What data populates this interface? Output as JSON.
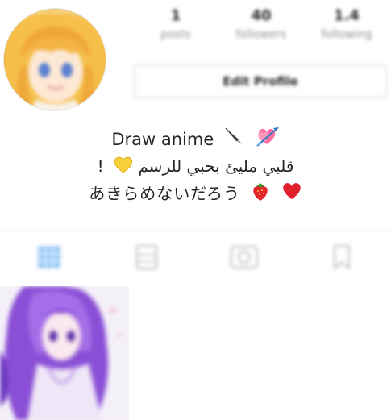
{
  "profile": {
    "stats": [
      {
        "value": "1",
        "label": "posts"
      },
      {
        "value": "40",
        "label": "followers"
      },
      {
        "value": "1.4",
        "label": "following"
      }
    ],
    "edit_profile_label": "Edit Profile"
  },
  "bio": {
    "line1_text": "Draw anime",
    "line2_text": "قلبي مليئ بحبي للرسم",
    "line2_suffix": "!",
    "line3_text": "あきらめないだろう"
  },
  "tabs": [
    {
      "icon": "grid-icon",
      "active": true
    },
    {
      "icon": "list-icon",
      "active": false
    },
    {
      "icon": "tagged-icon",
      "active": false
    },
    {
      "icon": "saved-icon",
      "active": false
    }
  ],
  "colors": {
    "accent": "#3897f0",
    "muted_icon": "#c7c7c7",
    "text": "#262626",
    "secondary": "#8e8e8e"
  }
}
